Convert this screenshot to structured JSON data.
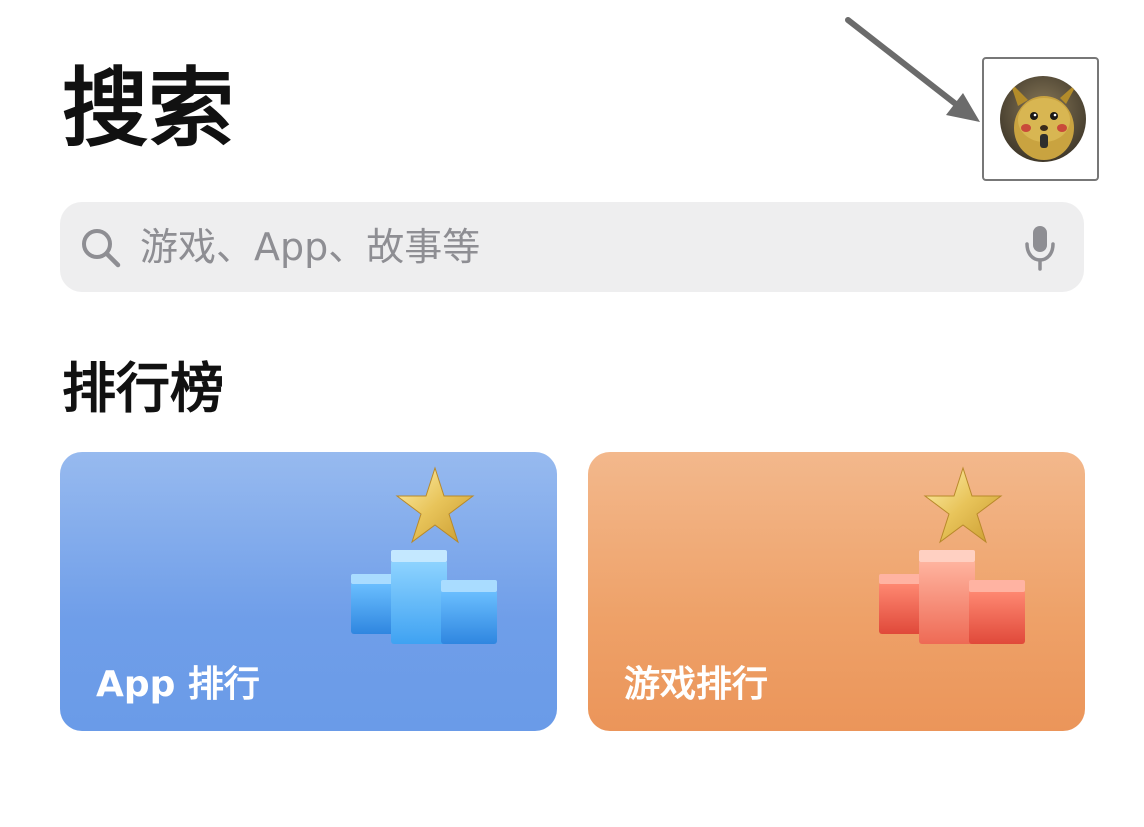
{
  "header": {
    "title": "搜索"
  },
  "search": {
    "placeholder": "游戏、App、故事等"
  },
  "charts_section": {
    "title": "排行榜",
    "cards": [
      {
        "label": "App 排行",
        "color": "#6f9ee9"
      },
      {
        "label": "游戏排行",
        "color": "#eea168"
      }
    ]
  },
  "icons": {
    "search": "search-icon",
    "mic": "mic-icon",
    "avatar": "profile-avatar",
    "trophy": "podium-star-icon"
  },
  "colors": {
    "background": "#ffffff",
    "search_bg": "#eeeeef",
    "placeholder": "#8e8e93",
    "app_card": "#6f9ee9",
    "game_card": "#eea168"
  }
}
